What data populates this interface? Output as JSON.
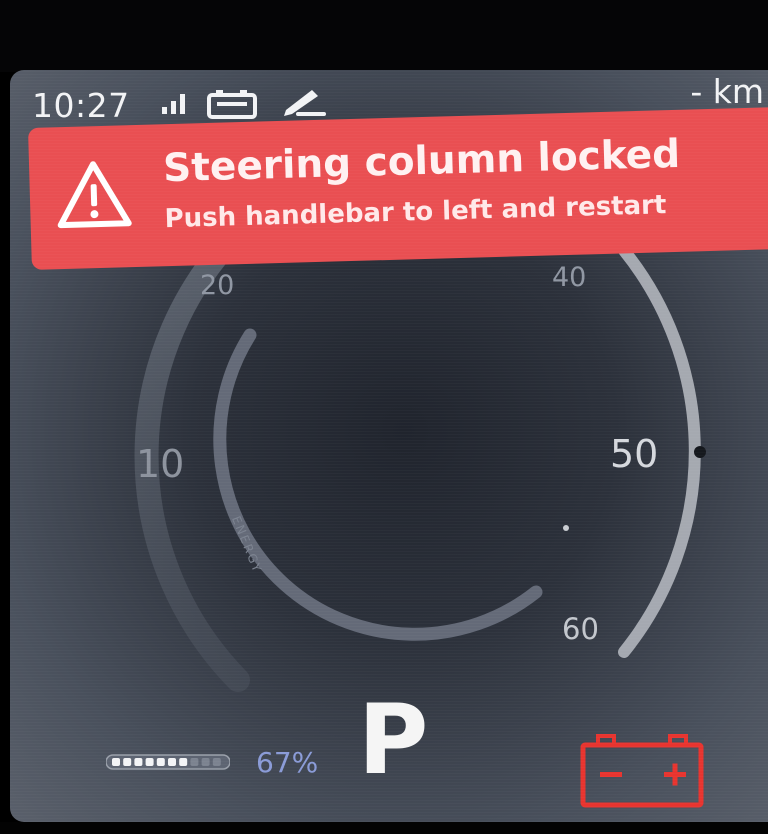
{
  "status_bar": {
    "time": "10:27",
    "range": "- km",
    "icons": [
      "signal-icon",
      "battery-status-icon",
      "edit-icon"
    ]
  },
  "alert": {
    "title": "Steering column locked",
    "subtitle": "Push handlebar to left and restart",
    "icon": "warning-triangle-icon",
    "color": "#e94f52"
  },
  "speedometer": {
    "tick_labels": [
      "10",
      "20",
      "40",
      "50",
      "60"
    ],
    "energy_label": "ENERGY"
  },
  "drive": {
    "gear": "P"
  },
  "battery": {
    "charge_percent_label": "67%",
    "charge_fraction": 0.67,
    "warning_icon": "battery-warning-icon",
    "warning_color": "#e8342f"
  }
}
